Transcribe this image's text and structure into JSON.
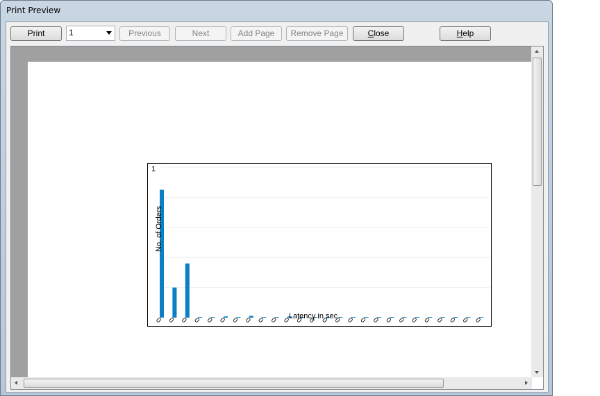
{
  "window": {
    "title": "Print Preview"
  },
  "toolbar": {
    "print": "Print",
    "page_select": "1",
    "previous": "Previous",
    "next": "Next",
    "add_page": "Add Page",
    "remove_page": "Remove Page",
    "close_c": "C",
    "close_rest": "lose",
    "help_h": "H",
    "help_rest": "elp"
  },
  "chart_data": {
    "type": "bar",
    "ylabel": "No. of Orders",
    "xlabel": "Latency in sec",
    "ytick_top": "1",
    "ylim": [
      0,
      1
    ],
    "grid": true,
    "color": "#0a7fc4",
    "categories": [
      "0",
      "0",
      "0",
      "0",
      "0",
      "0",
      "0",
      "0",
      "0",
      "0",
      "0",
      "0",
      "0",
      "0",
      "0",
      "0",
      "0",
      "0",
      "0",
      "0",
      "0",
      "0",
      "0",
      "0",
      "0",
      "0"
    ],
    "values": [
      0.85,
      0.2,
      0.36,
      0.004,
      0.002,
      0.008,
      0.004,
      0.012,
      0.003,
      0.002,
      0.008,
      0.003,
      0.002,
      0.002,
      0.002,
      0.002,
      0.002,
      0.002,
      0.002,
      0.002,
      0.002,
      0.002,
      0.002,
      0.002,
      0.002,
      0.002
    ]
  }
}
